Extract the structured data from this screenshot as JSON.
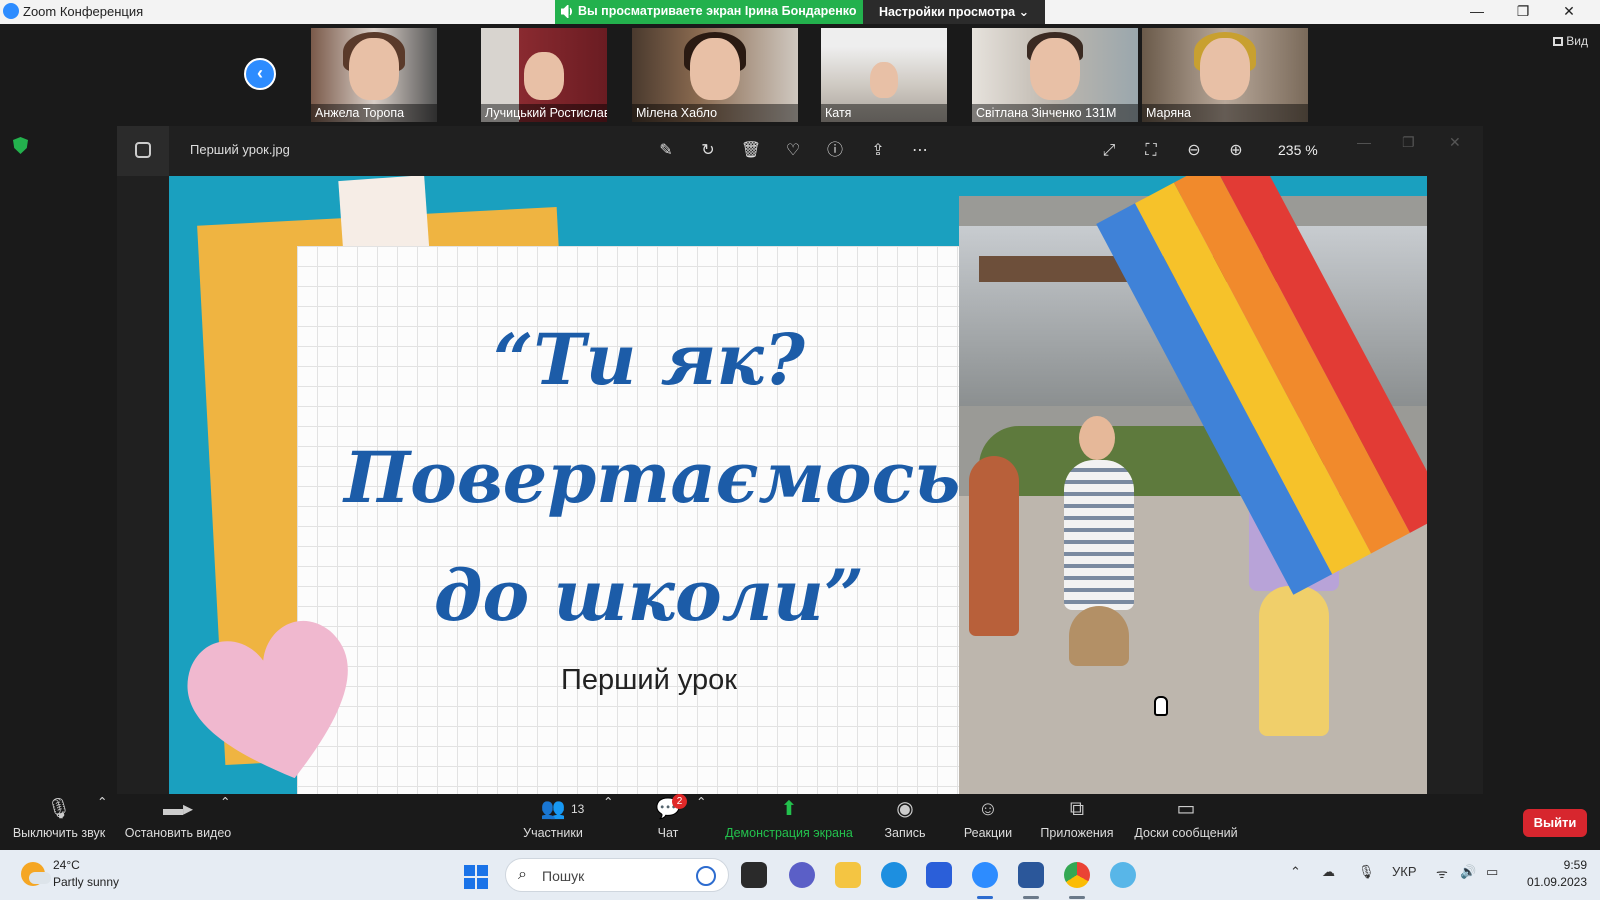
{
  "window": {
    "title": "Zoom Конференция",
    "share_banner": "Вы просматриваете экран Ірина Бондаренко",
    "view_settings": "Настройки просмотра",
    "controls": {
      "minimize": "—",
      "maximize": "❐",
      "close": "✕"
    }
  },
  "participants": {
    "view_label": "Вид",
    "tiles": [
      {
        "name": "Анжела Торопа"
      },
      {
        "name": "Лучицький Ростислав"
      },
      {
        "name": "Мілена Хабло"
      },
      {
        "name": "Катя"
      },
      {
        "name": "Світлана Зінченко 131М"
      },
      {
        "name": "Маряна"
      }
    ]
  },
  "viewer": {
    "filename": "Перший урок.jpg",
    "zoom": "235 %",
    "slide": {
      "title_line1": "“Ти як?",
      "title_line2": "Повертаємось",
      "title_line3": "до школи”",
      "subtitle": "Перший урок"
    }
  },
  "meeting_controls": {
    "mute": "Выключить звук",
    "stop_video": "Остановить видео",
    "participants": "Участники",
    "participants_count": "13",
    "chat": "Чат",
    "chat_badge": "2",
    "share_screen": "Демонстрация экрана",
    "record": "Запись",
    "reactions": "Реакции",
    "apps": "Приложения",
    "whiteboards": "Доски сообщений",
    "leave": "Выйти"
  },
  "taskbar": {
    "weather_temp": "24°C",
    "weather_desc": "Partly sunny",
    "search_placeholder": "Пошук",
    "language": "УКР",
    "time": "9:59",
    "date": "01.09.2023"
  },
  "colors": {
    "zoom_blue": "#2d8cff",
    "share_green": "#23b14d",
    "leave_red": "#d7262e",
    "slide_blue_text": "#1c5ca8",
    "slide_background": "#1aa0bf"
  }
}
